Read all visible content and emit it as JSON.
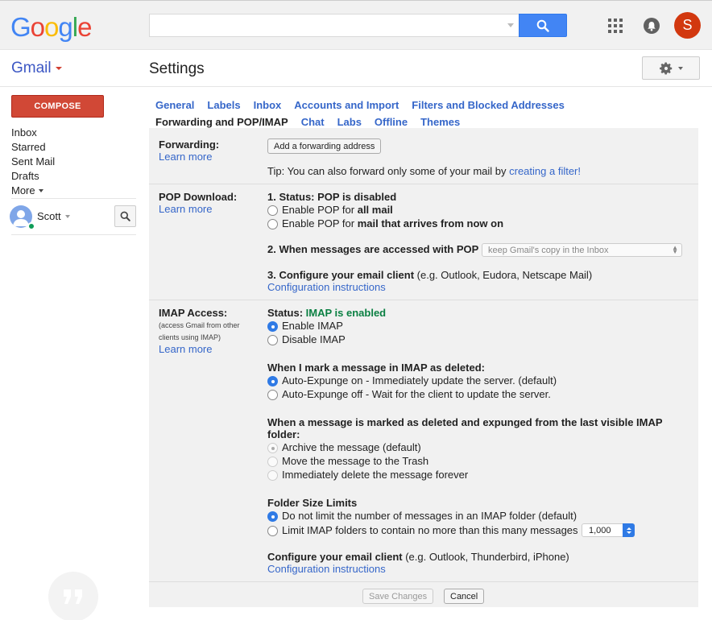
{
  "header": {
    "logo_letters": [
      {
        "ch": "G",
        "color": "#4285f4"
      },
      {
        "ch": "o",
        "color": "#ea4335"
      },
      {
        "ch": "o",
        "color": "#fbbc05"
      },
      {
        "ch": "g",
        "color": "#4285f4"
      },
      {
        "ch": "l",
        "color": "#34a853"
      },
      {
        "ch": "e",
        "color": "#ea4335"
      }
    ],
    "search": {
      "value": "",
      "placeholder": ""
    },
    "avatar_initial": "S",
    "icons": {
      "search": "search-icon",
      "apps": "apps-grid-icon",
      "notifications": "bell-icon"
    }
  },
  "subheader": {
    "app_label": "Gmail",
    "page_title": "Settings",
    "settings_icon": "gear-icon"
  },
  "sidebar": {
    "compose_label": "COMPOSE",
    "items": [
      {
        "label": "Inbox"
      },
      {
        "label": "Starred"
      },
      {
        "label": "Sent Mail"
      },
      {
        "label": "Drafts"
      },
      {
        "label": "More"
      }
    ],
    "user": {
      "name": "Scott",
      "status": "online"
    }
  },
  "tabs": {
    "row1": [
      "General",
      "Labels",
      "Inbox",
      "Accounts and Import",
      "Filters and Blocked Addresses"
    ],
    "row2": [
      "Forwarding and POP/IMAP",
      "Chat",
      "Labs",
      "Offline",
      "Themes"
    ],
    "active": "Forwarding and POP/IMAP"
  },
  "forwarding": {
    "label": "Forwarding:",
    "learn_more": "Learn more",
    "add_button": "Add a forwarding address",
    "tip_prefix": "Tip: You can also forward only some of your mail by ",
    "tip_link": "creating a filter!"
  },
  "pop": {
    "label": "POP Download:",
    "learn_more": "Learn more",
    "status_heading": "1. Status: POP is disabled",
    "option_all_prefix": "Enable POP for ",
    "option_all_bold": "all mail",
    "option_now_prefix": "Enable POP for ",
    "option_now_bold": "mail that arrives from now on",
    "access_heading": "2. When messages are accessed with POP",
    "access_select": "keep Gmail's copy in the Inbox",
    "client_heading": "3. Configure your email client",
    "client_examples": " (e.g. Outlook, Eudora, Netscape Mail)",
    "config_link": "Configuration instructions"
  },
  "imap": {
    "label": "IMAP Access:",
    "sub": "(access Gmail from other clients using IMAP)",
    "learn_more": "Learn more",
    "status_prefix": "Status: ",
    "status_value": "IMAP is enabled",
    "enable": "Enable IMAP",
    "disable": "Disable IMAP",
    "deleted_heading": "When I mark a message in IMAP as deleted:",
    "expunge_on": "Auto-Expunge on - Immediately update the server. (default)",
    "expunge_off": "Auto-Expunge off - Wait for the client to update the server.",
    "expunged_heading_1": "When a message is marked as deleted and expunged from the last visible IMAP",
    "expunged_heading_2": "folder:",
    "archive": "Archive the message (default)",
    "trash": "Move the message to the Trash",
    "delete_forever": "Immediately delete the message forever",
    "folder_heading": "Folder Size Limits",
    "no_limit": "Do not limit the number of messages in an IMAP folder (default)",
    "limit": "Limit IMAP folders to contain no more than this many messages",
    "limit_value": "1,000",
    "client_heading": "Configure your email client",
    "client_examples": " (e.g. Outlook, Thunderbird, iPhone)",
    "config_link": "Configuration instructions"
  },
  "footer": {
    "save": "Save Changes",
    "cancel": "Cancel"
  }
}
